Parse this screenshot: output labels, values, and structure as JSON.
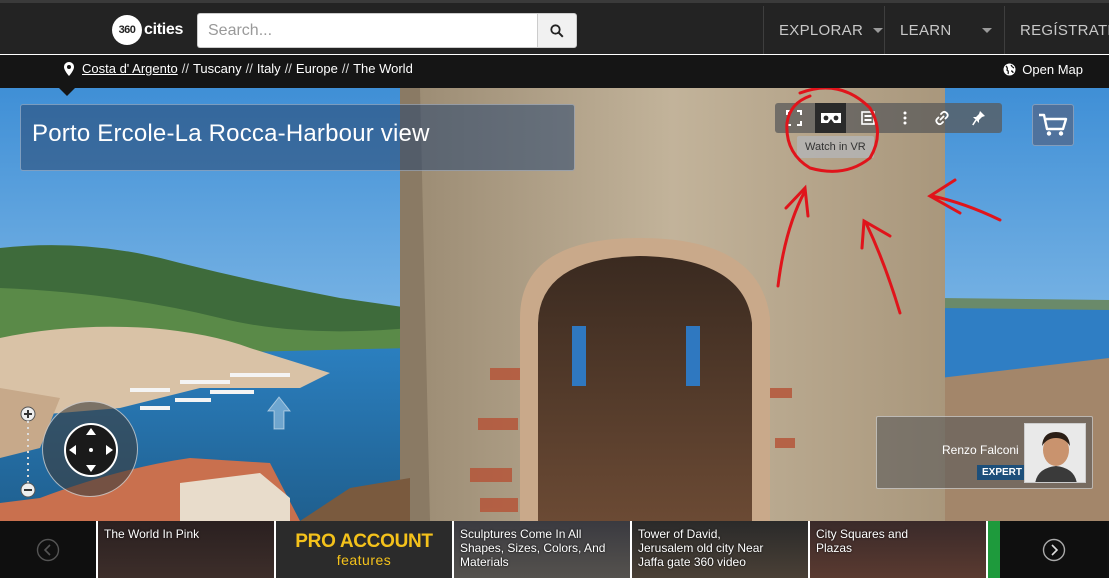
{
  "header": {
    "logo_number": "360",
    "logo_word": "cities",
    "search_placeholder": "Search...",
    "nav": [
      {
        "label": "EXPLORAR"
      },
      {
        "label": "LEARN"
      },
      {
        "label": "REGÍSTRATE/I"
      }
    ]
  },
  "breadcrumb": {
    "items": [
      "Costa d' Argento",
      "Tuscany",
      "Italy",
      "Europe",
      "The World"
    ],
    "separator": "//",
    "open_map": "Open Map"
  },
  "viewer": {
    "title": "Porto Ercole-La Rocca-Harbour view",
    "toolbar_icons": [
      "fullscreen-icon",
      "vr-headset-icon",
      "gallery-icon",
      "more-vertical-icon",
      "link-icon",
      "pin-icon"
    ],
    "tooltip": "Watch in VR",
    "author_name": "Renzo Falconi",
    "author_badge": "EXPERT"
  },
  "strip": {
    "cards": [
      {
        "label": "The World In Pink"
      },
      {
        "label_line1": "PRO ACCOUNT",
        "label_line2": "features"
      },
      {
        "label": "Sculptures Come In All Shapes, Sizes, Colors, And Materials"
      },
      {
        "label": "Tower of David, Jerusalem old city Near Jaffa gate 360 video"
      },
      {
        "label": "City Squares and Plazas"
      }
    ]
  },
  "colors": {
    "accent_gold": "#f4c21b",
    "badge_blue": "#1d4f7a",
    "annotation_red": "#e0141b"
  }
}
